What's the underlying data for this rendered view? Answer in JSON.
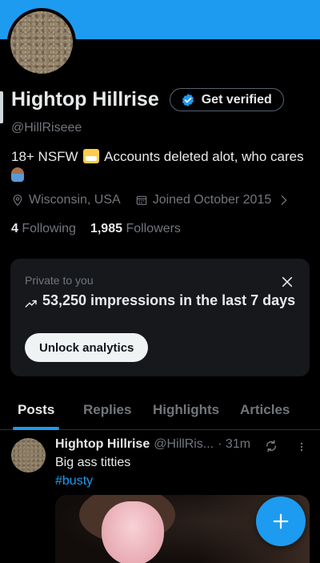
{
  "profile": {
    "name": "Hightop Hillrise",
    "handle": "@HillRiseee",
    "verify_label": "Get verified",
    "bio_text_1": "18+ NSFW",
    "bio_text_2": "Accounts deleted alot, who cares",
    "location": "Wisconsin, USA",
    "joined": "Joined October 2015",
    "following_count": "4",
    "following_label": "Following",
    "followers_count": "1,985",
    "followers_label": "Followers"
  },
  "analytics_card": {
    "private_label": "Private to you",
    "impressions_text": "53,250 impressions in the last 7 days",
    "unlock_label": "Unlock analytics"
  },
  "tabs": [
    {
      "label": "Posts",
      "active": true
    },
    {
      "label": "Replies",
      "active": false
    },
    {
      "label": "Highlights",
      "active": false
    },
    {
      "label": "Articles",
      "active": false
    }
  ],
  "post": {
    "name": "Hightop Hillrise",
    "handle": "@HillRis...",
    "time": "· 31m",
    "text": "Big ass titties",
    "hashtag": "#busty"
  },
  "colors": {
    "accent": "#1d9bf0",
    "background": "#000000",
    "card": "#16181c",
    "secondary_text": "#71767b"
  },
  "icons": [
    "verified-badge-icon",
    "location-pin-icon",
    "calendar-icon",
    "chevron-right-icon",
    "close-icon",
    "trending-up-icon",
    "sync-icon",
    "more-icon",
    "compose-plus-icon"
  ]
}
